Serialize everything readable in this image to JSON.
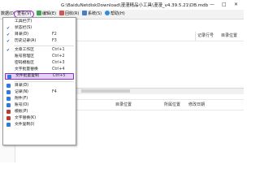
{
  "window": {
    "title": "G:\\BaiduNetdiskDownload\\漫漫精品小工具\\漫漫_v4.39.5.21\\DB.mdb",
    "minimize": "—",
    "maximize": "□",
    "close": "✕"
  },
  "menubar": {
    "items": [
      {
        "label": "数据(D)",
        "icon": "database-icon",
        "color": ""
      },
      {
        "label": "查看(V)",
        "icon": "",
        "color": ""
      },
      {
        "label": "编辑(E)",
        "icon": "edit-icon",
        "color": "#3aa655"
      },
      {
        "label": "回收(R)",
        "icon": "recycle-icon",
        "color": "#d9534f"
      },
      {
        "label": "系统(S)",
        "icon": "settings-icon",
        "color": "#4a7dc9"
      },
      {
        "label": "帮助(H)",
        "icon": "help-icon",
        "color": "#2d8de0"
      }
    ]
  },
  "view_menu": {
    "items": [
      {
        "label": "工具栏(T)",
        "key": "",
        "check": false,
        "icon": "",
        "color": ""
      },
      {
        "label": "状态栏(S)",
        "key": "",
        "check": true,
        "icon": "",
        "color": ""
      },
      {
        "label": "目录(D)",
        "key": "F2",
        "check": true,
        "icon": "",
        "color": ""
      },
      {
        "label": "历史记录(A)",
        "key": "F3",
        "check": true,
        "icon": "",
        "color": ""
      },
      {
        "label": "文章工作区",
        "key": "Ctrl+1",
        "check": true,
        "icon": "",
        "color": ""
      },
      {
        "label": "账号管理区",
        "key": "Ctrl+2",
        "check": false,
        "icon": "",
        "color": ""
      },
      {
        "label": "密码模板区",
        "key": "Ctrl+3",
        "check": false,
        "icon": "",
        "color": ""
      },
      {
        "label": "文字批量替换",
        "key": "Ctrl+4",
        "check": false,
        "icon": "",
        "color": ""
      },
      {
        "label": "文件批量复制",
        "key": "Ctrl+5",
        "check": false,
        "icon": "",
        "color": ""
      },
      {
        "label": "目录(D)",
        "key": "",
        "check": false,
        "icon": "folder-icon",
        "color": "#2c7be5"
      },
      {
        "label": "记录(N)",
        "key": "F4",
        "check": false,
        "icon": "record-icon",
        "color": "#2c7be5"
      },
      {
        "label": "附件(F)",
        "key": "",
        "check": false,
        "icon": "attachment-icon",
        "color": "#2c7be5"
      },
      {
        "label": "账号(O)",
        "key": "",
        "check": false,
        "icon": "account-icon",
        "color": "#2c7be5"
      },
      {
        "label": "模板(P)",
        "key": "",
        "check": false,
        "icon": "template-icon",
        "color": "#c0392b"
      },
      {
        "label": "文字替换(K)",
        "key": "",
        "check": false,
        "icon": "replace-icon",
        "color": "#c0392b"
      },
      {
        "label": "文件复制(I)",
        "key": "",
        "check": false,
        "icon": "copy-icon",
        "color": "#2c7be5"
      }
    ]
  },
  "table_headers_top": [
    "记录行号",
    "目录位置"
  ],
  "table_headers_bottom": [
    "目录位置",
    "所属位置",
    "修改日期"
  ]
}
